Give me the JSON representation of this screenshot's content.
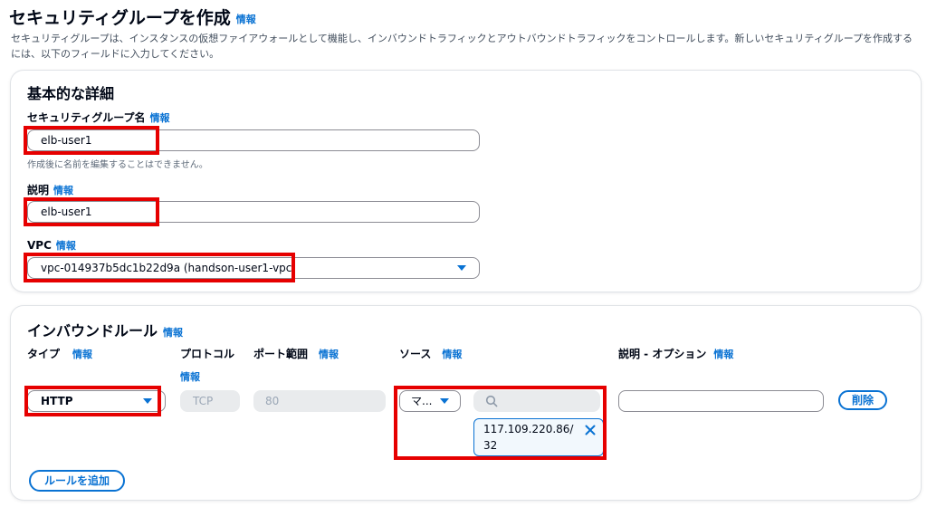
{
  "page": {
    "title": "セキュリティグループを作成",
    "title_info": "情報",
    "description": "セキュリティグループは、インスタンスの仮想ファイアウォールとして機能し、インバウンドトラフィックとアウトバウンドトラフィックをコントロールします。新しいセキュリティグループを作成するには、以下のフィールドに入力してください。"
  },
  "basic": {
    "title": "基本的な詳細",
    "name_label": "セキュリティグループ名",
    "name_info": "情報",
    "name_value": "elb-user1",
    "name_hint": "作成後に名前を編集することはできません。",
    "desc_label": "説明",
    "desc_info": "情報",
    "desc_value": "elb-user1",
    "vpc_label": "VPC",
    "vpc_info": "情報",
    "vpc_value": "vpc-014937b5dc1b22d9a (handson-user1-vpc)"
  },
  "inbound": {
    "title": "インバウンドルール",
    "title_info": "情報",
    "col_type": "タイプ",
    "col_type_info": "情報",
    "col_protocol": "プロトコル",
    "col_protocol_info": "情報",
    "col_port": "ポート範囲",
    "col_port_info": "情報",
    "col_source": "ソース",
    "col_source_info": "情報",
    "col_desc": "説明 - オプション",
    "col_desc_info": "情報",
    "rule": {
      "type": "HTTP",
      "protocol": "TCP",
      "port": "80",
      "source_select": "マ...",
      "source_token_line1": "117.109.220.86/",
      "source_token_line2": "32",
      "desc_value": ""
    },
    "delete_label": "削除",
    "add_rule_label": "ルールを追加"
  },
  "icons": [
    "search-icon",
    "close-icon",
    "caret-down-icon"
  ],
  "colors": {
    "accent": "#0972d3",
    "highlight": "#e60000"
  }
}
